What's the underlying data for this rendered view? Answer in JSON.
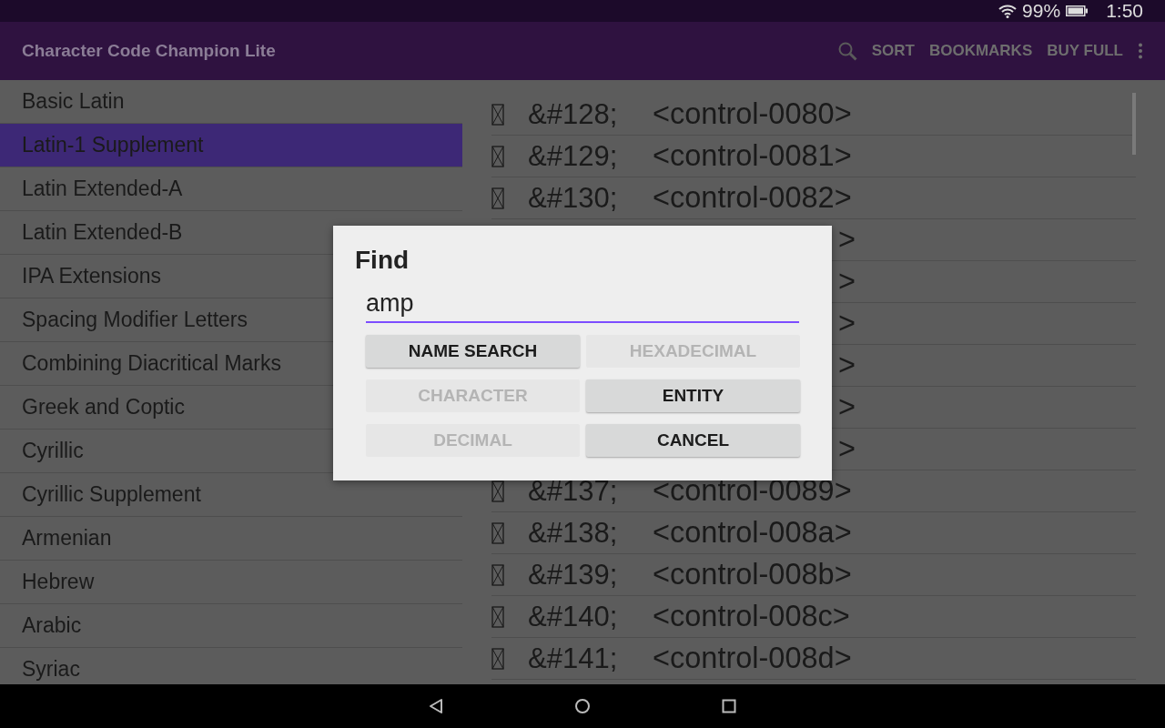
{
  "status_bar": {
    "battery": "99%",
    "time": "1:50"
  },
  "app_bar": {
    "title": "Character Code Champion Lite",
    "actions": [
      "SORT",
      "BOOKMARKS",
      "BUY FULL"
    ]
  },
  "blocks": [
    {
      "label": "Basic Latin",
      "selected": false
    },
    {
      "label": "Latin-1 Supplement",
      "selected": true
    },
    {
      "label": "Latin Extended-A",
      "selected": false
    },
    {
      "label": "Latin Extended-B",
      "selected": false
    },
    {
      "label": "IPA Extensions",
      "selected": false
    },
    {
      "label": "Spacing Modifier Letters",
      "selected": false
    },
    {
      "label": "Combining Diacritical Marks",
      "selected": false
    },
    {
      "label": "Greek and Coptic",
      "selected": false
    },
    {
      "label": "Cyrillic",
      "selected": false
    },
    {
      "label": "Cyrillic Supplement",
      "selected": false
    },
    {
      "label": "Armenian",
      "selected": false
    },
    {
      "label": "Hebrew",
      "selected": false
    },
    {
      "label": "Arabic",
      "selected": false
    },
    {
      "label": "Syriac",
      "selected": false
    }
  ],
  "characters": [
    {
      "kind": "full",
      "entity": "&#128;",
      "name": "<control-0080>"
    },
    {
      "kind": "full",
      "entity": "&#129;",
      "name": "<control-0081>"
    },
    {
      "kind": "full",
      "entity": "&#130;",
      "name": "<control-0082>"
    },
    {
      "kind": "tail",
      "text": ">"
    },
    {
      "kind": "tail",
      "text": ">"
    },
    {
      "kind": "tail",
      "text": ">"
    },
    {
      "kind": "tail",
      "text": ">"
    },
    {
      "kind": "tail",
      "text": ">"
    },
    {
      "kind": "tail",
      "text": ">"
    },
    {
      "kind": "full",
      "entity": "&#137;",
      "name": "<control-0089>"
    },
    {
      "kind": "full",
      "entity": "&#138;",
      "name": "<control-008a>"
    },
    {
      "kind": "full",
      "entity": "&#139;",
      "name": "<control-008b>"
    },
    {
      "kind": "full",
      "entity": "&#140;",
      "name": "<control-008c>"
    },
    {
      "kind": "full",
      "entity": "&#141;",
      "name": "<control-008d>"
    }
  ],
  "dialog": {
    "title": "Find",
    "value": "amp",
    "buttons": [
      {
        "label": "NAME SEARCH",
        "disabled": false
      },
      {
        "label": "HEXADECIMAL",
        "disabled": true
      },
      {
        "label": "CHARACTER",
        "disabled": true
      },
      {
        "label": "ENTITY",
        "disabled": false
      },
      {
        "label": "DECIMAL",
        "disabled": true
      },
      {
        "label": "CANCEL",
        "disabled": false
      }
    ]
  }
}
